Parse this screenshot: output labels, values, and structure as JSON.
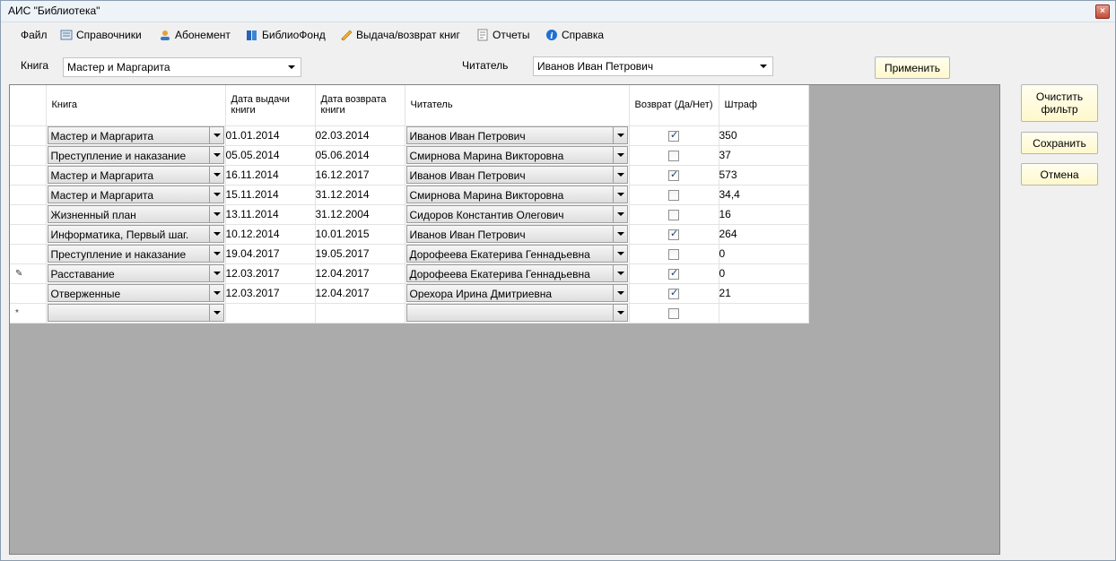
{
  "window": {
    "title": "АИС \"Библиотека\"",
    "close_label": "×"
  },
  "menu": [
    {
      "label": "Файл",
      "icon": ""
    },
    {
      "label": "Справочники",
      "icon": "book-list-icon"
    },
    {
      "label": "Абонемент",
      "icon": "user-card-icon"
    },
    {
      "label": "БиблиоФонд",
      "icon": "books-icon"
    },
    {
      "label": "Выдача/возврат книг",
      "icon": "pencil-icon"
    },
    {
      "label": "Отчеты",
      "icon": "report-icon"
    },
    {
      "label": "Справка",
      "icon": "info-icon"
    }
  ],
  "filter": {
    "book_label": "Книга",
    "book_value": "Мастер и Маргарита",
    "reader_label": "Читатель",
    "reader_value": "Иванов Иван Петрович",
    "apply_label": "Применить"
  },
  "side_buttons": {
    "clear": "Очистить фильтр",
    "save": "Сохранить",
    "cancel": "Отмена"
  },
  "grid": {
    "columns": [
      "Книга",
      "Дата выдачи книги",
      "Дата возврата книги",
      "Читатель",
      "Возврат (Да/Нет)",
      "Штраф"
    ],
    "rows": [
      {
        "marker": "",
        "book": "Мастер и Маргарита",
        "issued": "01.01.2014",
        "returned": "02.03.2014",
        "reader": "Иванов Иван Петрович",
        "returned_flag": true,
        "fine": "350"
      },
      {
        "marker": "",
        "book": "Преступление и наказание",
        "issued": "05.05.2014",
        "returned": "05.06.2014",
        "reader": "Смирнова Марина Викторовна",
        "returned_flag": false,
        "fine": "37"
      },
      {
        "marker": "",
        "book": "Мастер и Маргарита",
        "issued": "16.11.2014",
        "returned": "16.12.2017",
        "reader": "Иванов Иван Петрович",
        "returned_flag": true,
        "fine": "573"
      },
      {
        "marker": "",
        "book": "Мастер и Маргарита",
        "issued": "15.11.2014",
        "returned": "31.12.2014",
        "reader": "Смирнова Марина Викторовна",
        "returned_flag": false,
        "fine": "34,4"
      },
      {
        "marker": "",
        "book": "Жизненный план",
        "issued": "13.11.2014",
        "returned": "31.12.2004",
        "reader": "Сидоров Константив Олегович",
        "returned_flag": false,
        "fine": "16"
      },
      {
        "marker": "",
        "book": "Информатика, Первый шаг.",
        "issued": "10.12.2014",
        "returned": "10.01.2015",
        "reader": "Иванов Иван Петрович",
        "returned_flag": true,
        "fine": "264"
      },
      {
        "marker": "",
        "book": "Преступление и наказание",
        "issued": "19.04.2017",
        "returned": "19.05.2017",
        "reader": "Дорофеева Екатерива Геннадьевна",
        "returned_flag": false,
        "fine": "0"
      },
      {
        "marker": "✎",
        "book": "Расставание",
        "issued": "12.03.2017",
        "returned": "12.04.2017",
        "reader": "Дорофеева Екатерива Геннадьевна",
        "returned_flag": true,
        "fine": "0"
      },
      {
        "marker": "",
        "book": "Отверженные",
        "issued": "12.03.2017",
        "returned": "12.04.2017",
        "reader": "Орехора Ирина Дмитриевна",
        "returned_flag": true,
        "fine": "21"
      },
      {
        "marker": "*",
        "book": "",
        "issued": "",
        "returned": "",
        "reader": "",
        "returned_flag": false,
        "fine": ""
      }
    ]
  }
}
